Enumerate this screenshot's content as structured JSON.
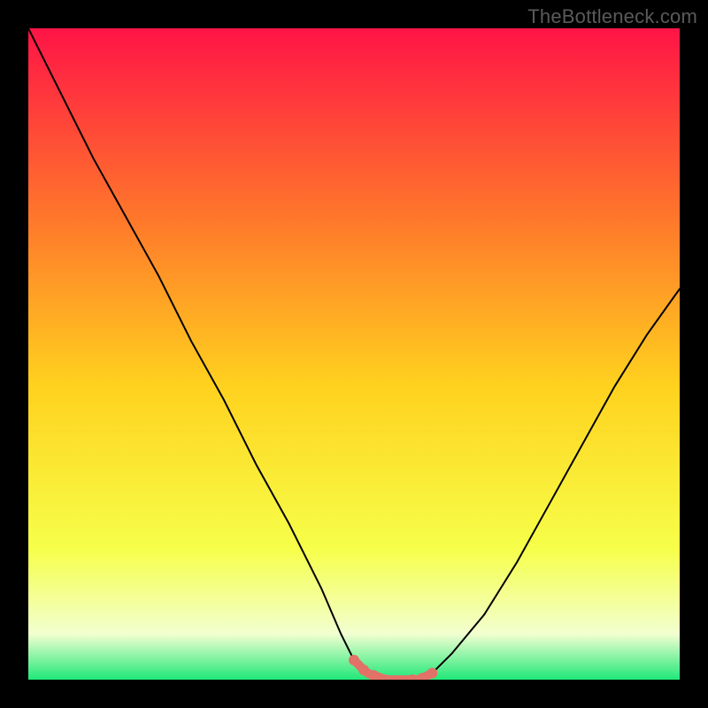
{
  "watermark": "TheBottleneck.com",
  "colors": {
    "frame": "#000000",
    "gradient_top": "#ff1446",
    "gradient_upper_mid": "#ff7a2a",
    "gradient_mid": "#ffd21e",
    "gradient_lower": "#f6ff4a",
    "gradient_pale": "#f2ffd0",
    "gradient_bottom": "#20e879",
    "curve": "#000000",
    "highlight": "#e27267"
  },
  "chart_data": {
    "type": "line",
    "title": "",
    "xlabel": "",
    "ylabel": "",
    "xlim": [
      0,
      100
    ],
    "ylim": [
      0,
      100
    ],
    "x": [
      0,
      5,
      10,
      15,
      20,
      25,
      30,
      35,
      40,
      45,
      48,
      50,
      52,
      55,
      58,
      60,
      62,
      65,
      70,
      75,
      80,
      85,
      90,
      95,
      100
    ],
    "values": [
      100,
      90,
      80,
      71,
      62,
      52,
      43,
      33,
      24,
      14,
      7,
      3,
      1,
      0,
      0,
      0,
      1,
      4,
      10,
      18,
      27,
      36,
      45,
      53,
      60
    ],
    "highlight_range_x": [
      50,
      62
    ],
    "annotations": []
  }
}
